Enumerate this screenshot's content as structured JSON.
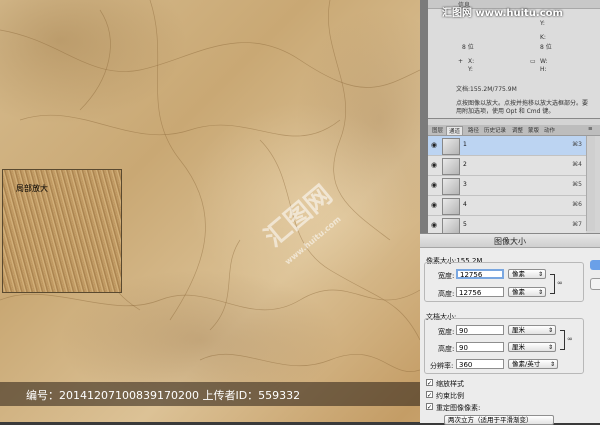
{
  "logo": {
    "text": "汇图网 www.huitu.com"
  },
  "canvas": {
    "zoom_label": "局部放大"
  },
  "watermark": {
    "center_text": "汇图网",
    "center_url": "www.huitu.com"
  },
  "caption": {
    "text": "编号：20141207100839170200 上传者ID：559332"
  },
  "info_panel": {
    "title": "信息",
    "rows": {
      "y1": "Y:",
      "k": "K:",
      "bits1": "8 位",
      "bits2": "8 位",
      "x": "X:",
      "y2": "Y:",
      "w": "W:",
      "h": "H:",
      "doc": "文档:155.2M/775.9M",
      "hint1": "点按图像以放大。点按并拖移以放大选框部分。要",
      "hint2": "用附加选项，使用 Opt 和 Cmd 键。"
    }
  },
  "channels_panel": {
    "tabs": [
      "图层",
      "通道",
      "路径",
      "历史记录",
      "调整",
      "蒙版",
      "动作"
    ],
    "active_tab": "通道",
    "rows": [
      {
        "name": "1",
        "key": "⌘3"
      },
      {
        "name": "2",
        "key": "⌘4"
      },
      {
        "name": "3",
        "key": "⌘5"
      },
      {
        "name": "4",
        "key": "⌘6"
      },
      {
        "name": "5",
        "key": "⌘7"
      }
    ]
  },
  "image_size": {
    "title": "图像大小",
    "pixel_dims_label": "像素大小:155.2M",
    "width_label": "宽度:",
    "width_value": "12756",
    "width_unit": "像素",
    "height_label": "高度:",
    "height_value": "12756",
    "height_unit": "像素",
    "doc_size_label": "文档大小:",
    "doc_width_label": "宽度:",
    "doc_width_value": "90",
    "doc_width_unit": "厘米",
    "doc_height_label": "高度:",
    "doc_height_value": "90",
    "doc_height_unit": "厘米",
    "resolution_label": "分辨率:",
    "resolution_value": "360",
    "resolution_unit": "像素/英寸",
    "scale_styles": "缩放样式",
    "constrain": "约束比例",
    "resample": "重定图像像素:",
    "resample_method": "两次立方（适用于平滑渐变）"
  }
}
